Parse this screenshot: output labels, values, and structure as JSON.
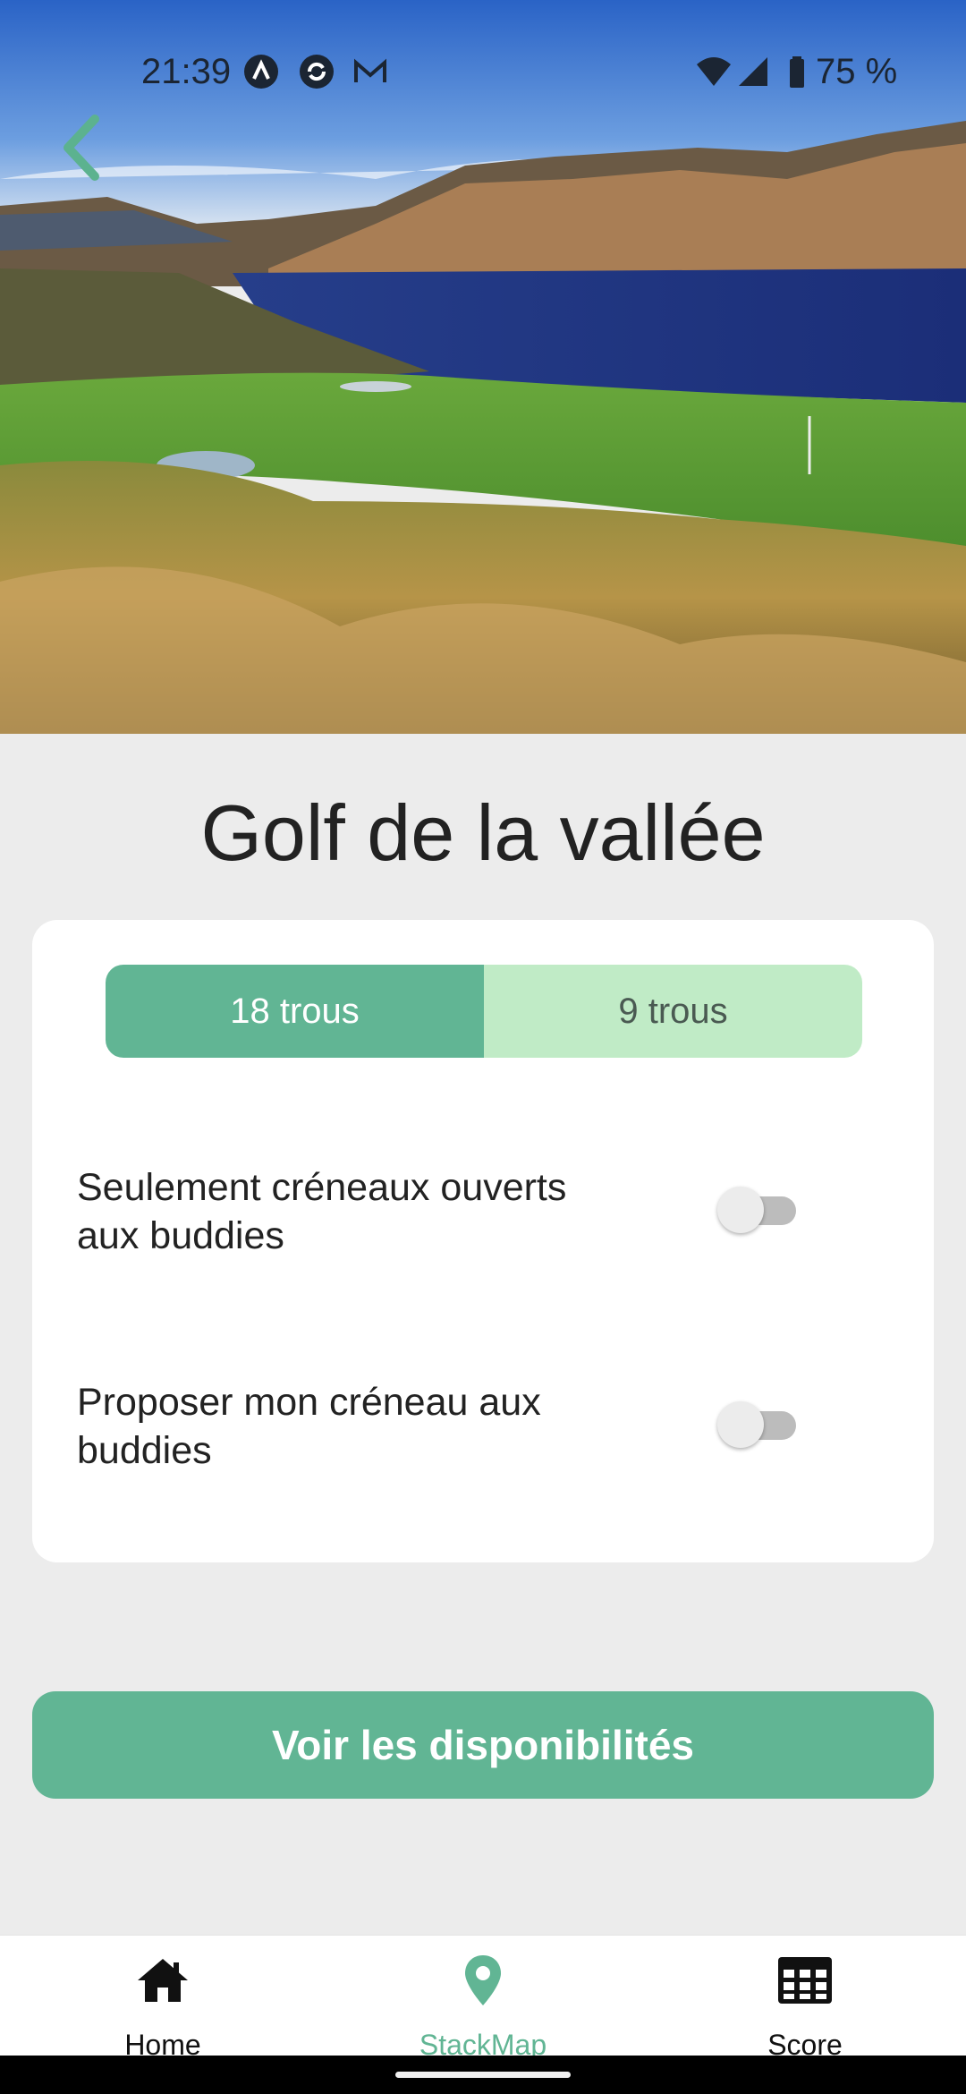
{
  "status_bar": {
    "time": "21:39",
    "notification_icons": [
      "app-a-icon",
      "sync-icon",
      "gmail-icon"
    ],
    "system_icons": [
      "wifi-icon",
      "signal-icon",
      "battery-icon"
    ],
    "battery_percent": "75 %"
  },
  "header": {
    "back_icon": "chevron-left-icon",
    "hero_image": "golf course by a lake with mountains"
  },
  "course": {
    "title": "Golf de la vallée"
  },
  "holes_selector": {
    "options": [
      "18 trous",
      "9 trous"
    ],
    "selected": "18 trous"
  },
  "options": [
    {
      "label": "Seulement créneaux ouverts aux buddies",
      "enabled": false
    },
    {
      "label": "Proposer mon créneau aux buddies",
      "enabled": false
    }
  ],
  "cta": {
    "label": "Voir les disponibilités"
  },
  "tab_bar": {
    "items": [
      {
        "label": "Home",
        "icon": "home-icon"
      },
      {
        "label": "StackMap",
        "icon": "map-pin-icon"
      },
      {
        "label": "Score",
        "icon": "grid-table-icon"
      }
    ],
    "active": "StackMap"
  },
  "colors": {
    "accent": "#61b594",
    "accent_light": "#c0ebc6",
    "background": "#ececec"
  }
}
